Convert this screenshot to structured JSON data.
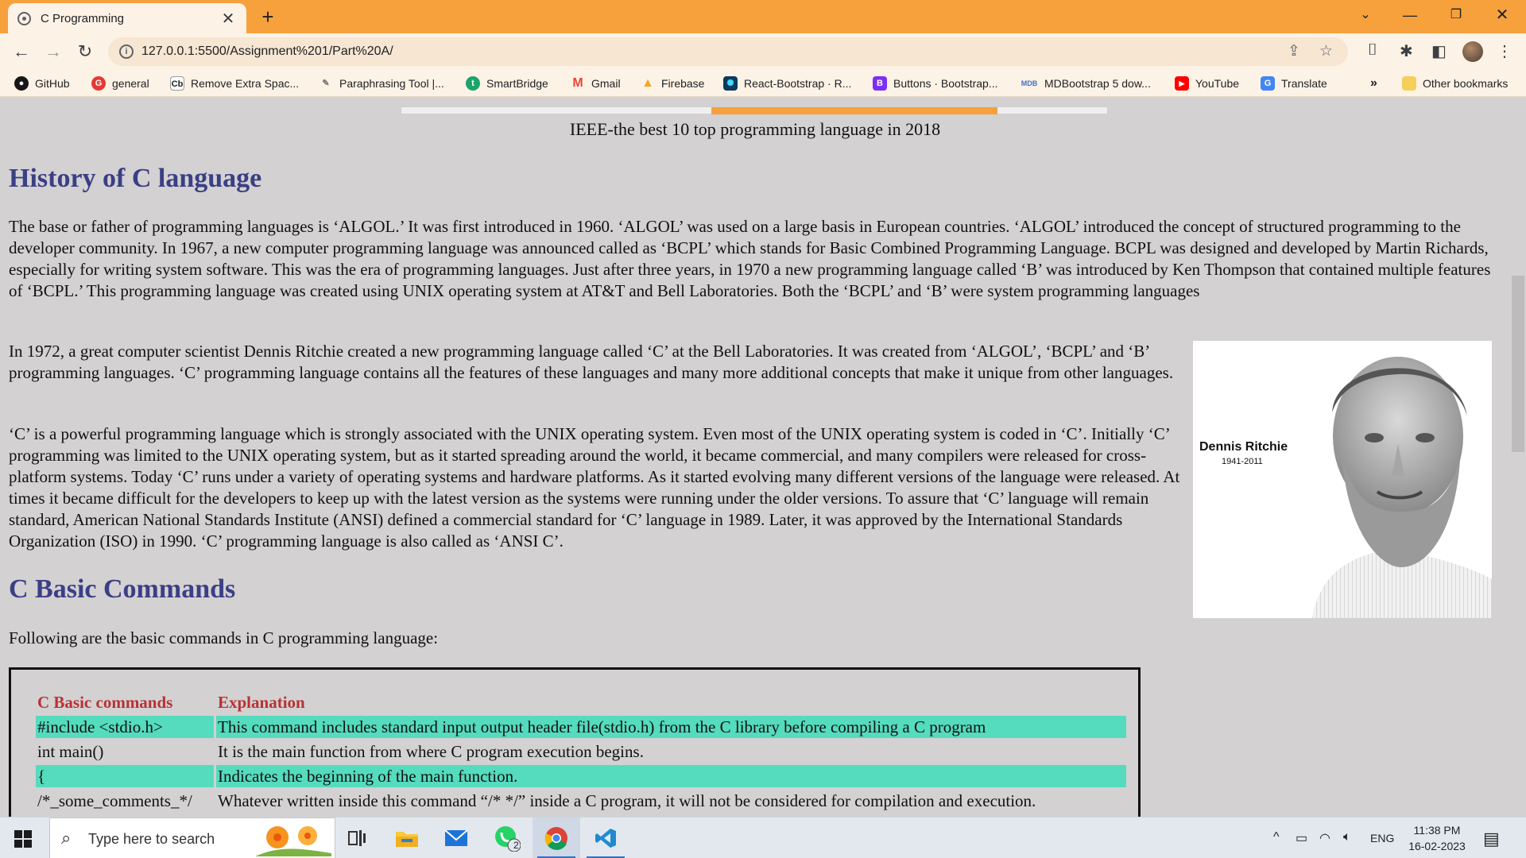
{
  "browser": {
    "tab_title": "C Programming",
    "url": "127.0.0.1:5500/Assignment%201/Part%20A/",
    "bookmarks": [
      {
        "label": "GitHub",
        "icon": "github-icon",
        "color": "#181717"
      },
      {
        "label": "general",
        "icon": "general-icon",
        "color": "#e53935"
      },
      {
        "label": "Remove Extra Spac...",
        "icon": "cb-icon",
        "color": "#222222"
      },
      {
        "label": "Paraphrasing Tool |...",
        "icon": "pen-icon",
        "color": "#777777"
      },
      {
        "label": "SmartBridge",
        "icon": "smartbridge-icon",
        "color": "#1aa36a"
      },
      {
        "label": "Gmail",
        "icon": "gmail-icon",
        "color": "#ea4335"
      },
      {
        "label": "Firebase",
        "icon": "firebase-icon",
        "color": "#f5a623"
      },
      {
        "label": "React-Bootstrap · R...",
        "icon": "react-bootstrap-icon",
        "color": "#0b3a5c"
      },
      {
        "label": "Buttons · Bootstrap...",
        "icon": "bootstrap-icon",
        "color": "#7b2ff7"
      },
      {
        "label": "MDBootstrap 5 dow...",
        "icon": "mdb-icon",
        "color": "#3b71ca"
      },
      {
        "label": "YouTube",
        "icon": "youtube-icon",
        "color": "#ff0000"
      },
      {
        "label": "Translate",
        "icon": "translate-icon",
        "color": "#4285f4"
      }
    ],
    "more_bookmarks": "»",
    "other_bookmarks": "Other bookmarks"
  },
  "content": {
    "image_caption": "IEEE-the best 10 top programming language in 2018",
    "history_heading": "History of C language",
    "history_p1": "The base or father of programming languages is ‘ALGOL.’ It was first introduced in 1960. ‘ALGOL’ was used on a large basis in European countries. ‘ALGOL’ introduced the concept of structured programming to the developer community. In 1967, a new computer programming language was announced called as ‘BCPL’ which stands for Basic Combined Programming Language. BCPL was designed and developed by Martin Richards, especially for writing system software. This was the era of programming languages. Just after three years, in 1970 a new programming language called ‘B’ was introduced by Ken Thompson that contained multiple features of ‘BCPL.’ This programming language was created using UNIX operating system at AT&T and Bell Laboratories. Both the ‘BCPL’ and ‘B’ were system programming languages",
    "history_p2": "In 1972, a great computer scientist Dennis Ritchie created a new programming language called ‘C’ at the Bell Laboratories. It was created from ‘ALGOL’, ‘BCPL’ and ‘B’ programming languages. ‘C’ programming language contains all the features of these languages and many more additional concepts that make it unique from other languages.",
    "history_p3": "‘C’ is a powerful programming language which is strongly associated with the UNIX operating system. Even most of the UNIX operating system is coded in ‘C’. Initially ‘C’ programming was limited to the UNIX operating system, but as it started spreading around the world, it became commercial, and many compilers were released for cross-platform systems. Today ‘C’ runs under a variety of operating systems and hardware platforms. As it started evolving many different versions of the language were released. At times it became difficult for the developers to keep up with the latest version as the systems were running under the older versions. To assure that ‘C’ language will remain standard, American National Standards Institute (ANSI) defined a commercial standard for ‘C’ language in 1989. Later, it was approved by the International Standards Organization (ISO) in 1990. ‘C’ programming language is also called as ‘ANSI C’.",
    "portrait_name": "Dennis Ritchie",
    "portrait_years": "1941-2011",
    "commands_heading": "C Basic Commands",
    "commands_intro": "Following are the basic commands in C programming language:",
    "table_headers": [
      "C Basic commands",
      "Explanation"
    ],
    "table_rows": [
      {
        "cmd": "#include <stdio.h>",
        "exp": "This command includes standard input output header file(stdio.h) from the C library before compiling a C program"
      },
      {
        "cmd": "int main()",
        "exp": "It is the main function from where C program execution begins."
      },
      {
        "cmd": "{",
        "exp": "Indicates the beginning of the main function."
      },
      {
        "cmd": "/*_some_comments_*/",
        "exp": "Whatever written inside this command “/* */” inside a C program, it will not be considered for compilation and execution."
      }
    ]
  },
  "taskbar": {
    "search_placeholder": "Type here to search",
    "whatsapp_badge": "2",
    "language": "ENG",
    "time": "11:38 PM",
    "date": "16-02-2023"
  },
  "colors": {
    "accent": "#f6a13c",
    "heading": "#3b3f85",
    "table_header": "#b83234",
    "row_highlight": "#55dbbe",
    "page_bg": "#d3d1d2"
  }
}
